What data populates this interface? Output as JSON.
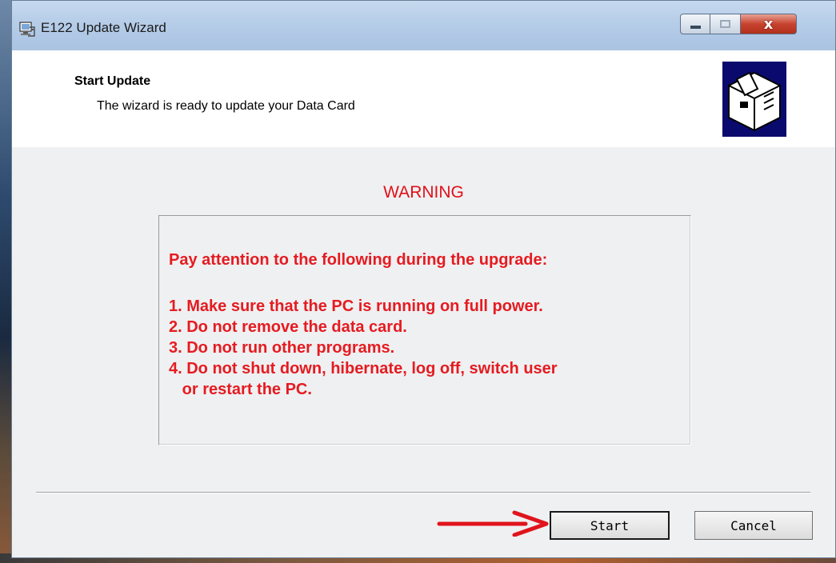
{
  "window": {
    "title": "E122 Update Wizard",
    "close_glyph": "x"
  },
  "header": {
    "title": "Start Update",
    "subtitle": "The wizard is ready to update your Data Card"
  },
  "warning": {
    "heading": "WARNING",
    "intro": "Pay attention to the following during the upgrade:",
    "items": [
      "1. Make sure that the PC is running on full power.",
      "2. Do not remove the data card.",
      "3. Do not run other programs.",
      "4. Do not shut down, hibernate, log off, switch user",
      "   or restart the PC."
    ]
  },
  "buttons": {
    "start": "Start",
    "cancel": "Cancel"
  },
  "colors": {
    "warning_red": "#e51b21",
    "annotation_arrow": "#e0141c"
  },
  "icons": {
    "app": "computer-setup-icon",
    "wizard": "install-box-icon",
    "annotation": "red-arrow-icon"
  }
}
